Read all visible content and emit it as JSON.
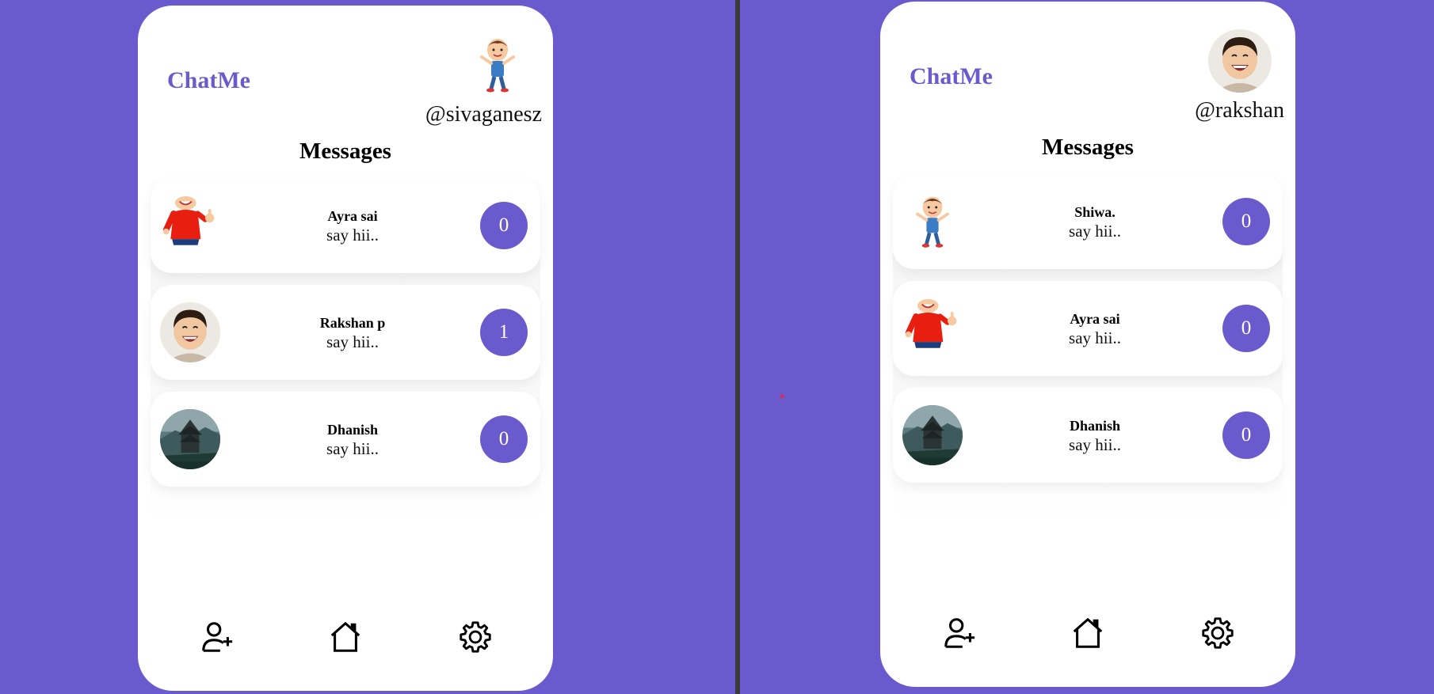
{
  "colors": {
    "accent": "#6a5acd",
    "background": "#6a5acd",
    "card": "#ffffff"
  },
  "left": {
    "brand": "ChatMe",
    "user": {
      "handle": "@sivaganesz",
      "avatar": "cartoon-boy-jumping"
    },
    "title": "Messages",
    "chats": [
      {
        "name": "Ayra sai",
        "message": "say hii..",
        "unread": "0",
        "avatar": "cartoon-boy-red-shirt"
      },
      {
        "name": "Rakshan p",
        "message": "say hii..",
        "unread": "1",
        "avatar": "photo-laughing-boy"
      },
      {
        "name": "Dhanish",
        "message": "say hii..",
        "unread": "0",
        "avatar": "photo-mountain-castle"
      }
    ],
    "nav": [
      "add-user-icon",
      "home-icon",
      "settings-icon"
    ]
  },
  "right": {
    "brand": "ChatMe",
    "user": {
      "handle": "@rakshan",
      "avatar": "photo-laughing-boy"
    },
    "title": "Messages",
    "chats": [
      {
        "name": "Shiwa.",
        "message": "say hii..",
        "unread": "0",
        "avatar": "cartoon-boy-jumping"
      },
      {
        "name": "Ayra sai",
        "message": "say hii..",
        "unread": "0",
        "avatar": "cartoon-boy-red-shirt"
      },
      {
        "name": "Dhanish",
        "message": "say hii..",
        "unread": "0",
        "avatar": "photo-mountain-castle"
      }
    ],
    "nav": [
      "add-user-icon",
      "home-icon",
      "settings-icon"
    ]
  }
}
